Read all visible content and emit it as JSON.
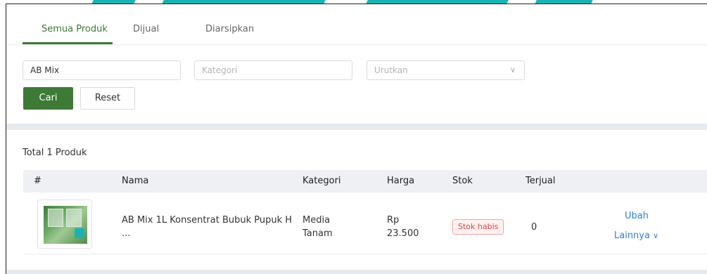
{
  "tabs": [
    {
      "label": "Semua Produk",
      "active": true
    },
    {
      "label": "Dijual",
      "active": false
    },
    {
      "label": "Diarsipkan",
      "active": false
    }
  ],
  "filters": {
    "search_value": "AB Mix",
    "category_placeholder": "Kategori",
    "sort_placeholder": "Urutkan",
    "search_button": "Cari",
    "reset_button": "Reset"
  },
  "table": {
    "total_label": "Total 1 Produk",
    "headers": [
      "#",
      "Nama",
      "Kategori",
      "Harga",
      "Stok",
      "Terjual"
    ],
    "rows": [
      {
        "name_line1": "AB Mix 1L Konsentrat Bubuk Pupuk H",
        "name_line2": "...",
        "category_line1": "Media",
        "category_line2": "Tanam",
        "price_line1": "Rp",
        "price_line2": "23.500",
        "stock_badge": "Stok habis",
        "sold": "0",
        "edit_action": "Ubah",
        "more_action": "Lainnya"
      }
    ]
  },
  "colors": {
    "accent": "#3d7a36",
    "link": "#2f7fd6",
    "badge_text": "#e04444",
    "badge_bg": "#fff1f0"
  },
  "icons": {
    "sort_dropdown": "chevron-down-icon",
    "more_dropdown": "chevron-down-icon"
  }
}
